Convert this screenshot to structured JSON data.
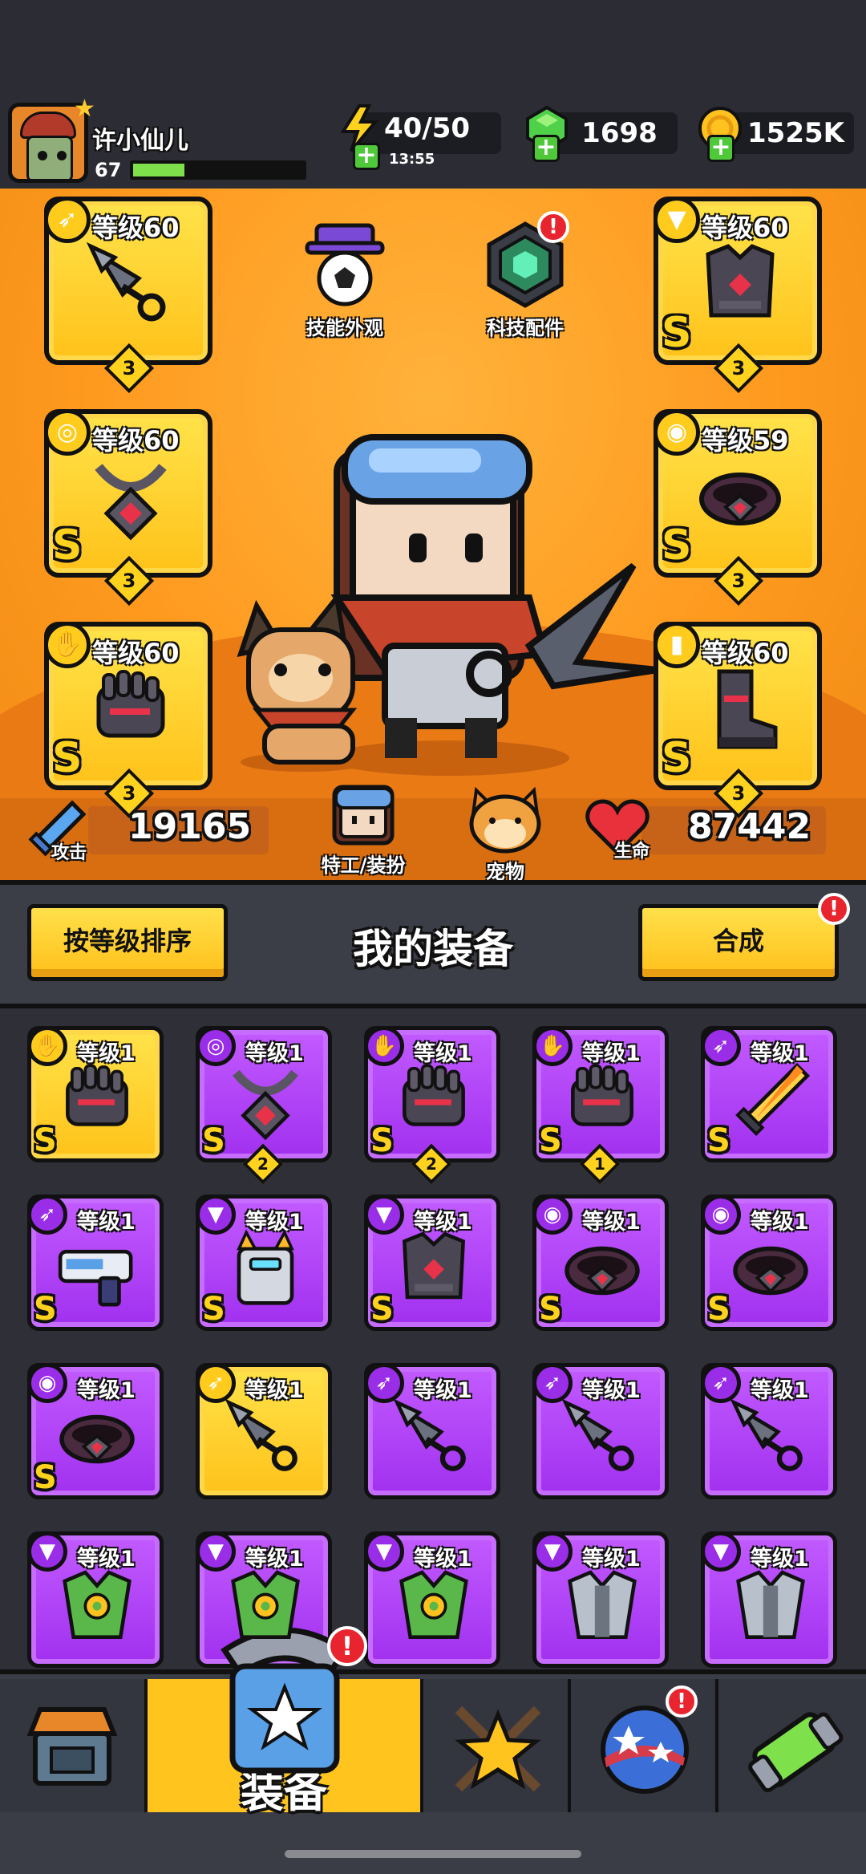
{
  "player": {
    "name": "许小仙儿",
    "level": "67",
    "xp_fraction": 0.3
  },
  "resources": {
    "energy": {
      "value": "40/50",
      "timer": "13:55",
      "color": "#ffd21e"
    },
    "gems": {
      "value": "1698",
      "color": "#4fd14a"
    },
    "coins": {
      "value": "1525K",
      "color": "#ffc21e"
    }
  },
  "hero_area": {
    "skill_skin": "技能外观",
    "tech_parts": "科技配件",
    "agent_outfit": "特工/装扮",
    "pet": "宠物",
    "attack": {
      "label": "攻击",
      "value": "19165"
    },
    "health": {
      "label": "生命",
      "value": "87442"
    },
    "tech_badge": "!"
  },
  "equipped": {
    "left": [
      {
        "type": "weapon",
        "level": "等级60",
        "rank": "",
        "count": "3"
      },
      {
        "type": "necklace",
        "level": "等级60",
        "rank": "S",
        "count": "3"
      },
      {
        "type": "glove",
        "level": "等级60",
        "rank": "S",
        "count": "3"
      }
    ],
    "right": [
      {
        "type": "armor",
        "level": "等级60",
        "rank": "S",
        "count": "3"
      },
      {
        "type": "belt",
        "level": "等级59",
        "rank": "S",
        "count": "3"
      },
      {
        "type": "boots",
        "level": "等级60",
        "rank": "S",
        "count": "3"
      }
    ]
  },
  "equip_bar": {
    "sort_button": "按等级排序",
    "title": "我的装备",
    "merge_button": "合成",
    "merge_badge": "!"
  },
  "inventory": [
    {
      "type": "glove",
      "color": "yellow",
      "level": "等级1",
      "rank": "S",
      "count": ""
    },
    {
      "type": "necklace",
      "color": "purple",
      "level": "等级1",
      "rank": "S",
      "count": "2"
    },
    {
      "type": "glove",
      "color": "purple",
      "level": "等级1",
      "rank": "S",
      "count": "2"
    },
    {
      "type": "glove",
      "color": "purple",
      "level": "等级1",
      "rank": "S",
      "count": "1"
    },
    {
      "type": "sword",
      "color": "purple",
      "level": "等级1",
      "rank": "S",
      "count": ""
    },
    {
      "type": "gun",
      "color": "purple",
      "level": "等级1",
      "rank": "S",
      "count": ""
    },
    {
      "type": "armor-robot",
      "color": "purple",
      "level": "等级1",
      "rank": "S",
      "count": ""
    },
    {
      "type": "armor",
      "color": "purple",
      "level": "等级1",
      "rank": "S",
      "count": ""
    },
    {
      "type": "belt",
      "color": "purple",
      "level": "等级1",
      "rank": "S",
      "count": ""
    },
    {
      "type": "belt",
      "color": "purple",
      "level": "等级1",
      "rank": "S",
      "count": ""
    },
    {
      "type": "belt",
      "color": "purple",
      "level": "等级1",
      "rank": "S",
      "count": ""
    },
    {
      "type": "weapon",
      "color": "yellow",
      "level": "等级1",
      "rank": "",
      "count": ""
    },
    {
      "type": "weapon",
      "color": "purple",
      "level": "等级1",
      "rank": "",
      "count": ""
    },
    {
      "type": "weapon",
      "color": "purple",
      "level": "等级1",
      "rank": "",
      "count": ""
    },
    {
      "type": "weapon",
      "color": "purple",
      "level": "等级1",
      "rank": "",
      "count": ""
    },
    {
      "type": "armor-green",
      "color": "purple",
      "level": "等级1",
      "rank": "",
      "count": ""
    },
    {
      "type": "armor-green",
      "color": "purple",
      "level": "等级1",
      "rank": "",
      "count": ""
    },
    {
      "type": "armor-green",
      "color": "purple",
      "level": "等级1",
      "rank": "",
      "count": ""
    },
    {
      "type": "armor-silver",
      "color": "purple",
      "level": "等级1",
      "rank": "",
      "count": ""
    },
    {
      "type": "armor-silver",
      "color": "purple",
      "level": "等级1",
      "rank": "",
      "count": ""
    }
  ],
  "bottom_nav": {
    "active_label": "装备",
    "equip_badge": "!",
    "event_badge": "!"
  }
}
